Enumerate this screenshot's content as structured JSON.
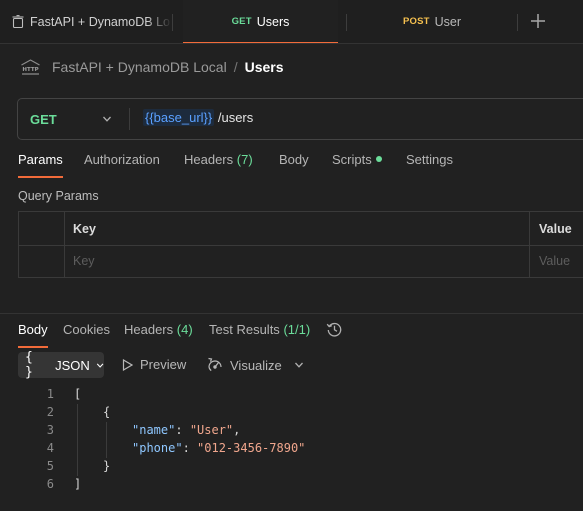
{
  "tabs": [
    {
      "icon": "trash-icon",
      "label": "FastAPI + DynamoDB Lo",
      "active": false
    },
    {
      "method": "GET",
      "label": "Users",
      "active": true
    },
    {
      "method": "POST",
      "label": "User",
      "active": false
    }
  ],
  "new_tab_icon": "plus-icon",
  "breadcrumb": {
    "icon": "http-icon",
    "collection": "FastAPI + DynamoDB Local",
    "separator": "/",
    "request": "Users"
  },
  "request": {
    "method": "GET",
    "url_variable": "{{base_url}}",
    "url_path": " /users"
  },
  "request_tabs": [
    {
      "label": "Params",
      "active": true
    },
    {
      "label": "Authorization"
    },
    {
      "label": "Headers",
      "count": "(7)"
    },
    {
      "label": "Body"
    },
    {
      "label": "Scripts",
      "indicator": true
    },
    {
      "label": "Settings"
    }
  ],
  "query_params": {
    "title": "Query Params",
    "columns": [
      "Key",
      "Value"
    ],
    "placeholders": [
      "Key",
      "Value"
    ]
  },
  "response_tabs": [
    {
      "label": "Body",
      "active": true
    },
    {
      "label": "Cookies"
    },
    {
      "label": "Headers",
      "count": "(4)"
    },
    {
      "label": "Test Results",
      "count": "(1/1)"
    }
  ],
  "response_toolbar": {
    "format_icon": "braces-icon",
    "format": "JSON",
    "preview": "Preview",
    "visualize": "Visualize"
  },
  "response_body": {
    "line_numbers": [
      "1",
      "2",
      "3",
      "4",
      "5",
      "6"
    ],
    "open_bracket": "[",
    "open_brace": "{",
    "fields": [
      {
        "key": "\"name\"",
        "colon": ": ",
        "value": "\"User\"",
        "trail": ","
      },
      {
        "key": "\"phone\"",
        "colon": ": ",
        "value": "\"012-3456-7890\"",
        "trail": ""
      }
    ],
    "close_brace": "}",
    "close_bracket": "]"
  },
  "colors": {
    "accent": "#f26b3a",
    "get": "#6bdd9a",
    "post": "#f5c04f",
    "json_key": "#8fc7ff",
    "json_string": "#f0a68d"
  }
}
